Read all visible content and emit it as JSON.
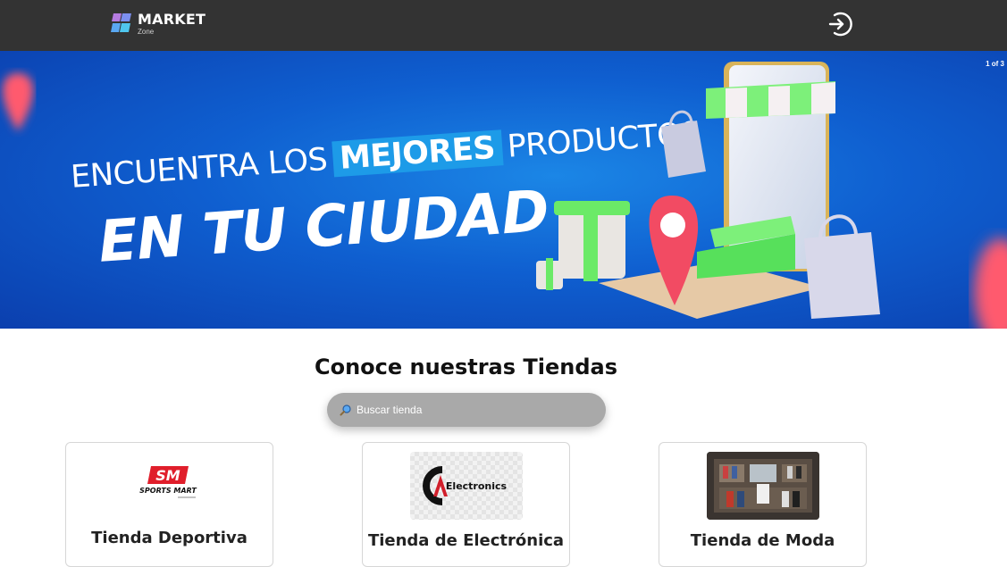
{
  "header": {
    "brand_title": "MARKET",
    "brand_subtitle": "Zone",
    "login_icon": "login-icon"
  },
  "banner": {
    "counter": "1 of 3",
    "line1_before": "ENCUENTRA LOS",
    "line1_highlight": "MEJORES",
    "line1_after": "PRODUCTOS",
    "line2": "EN TU CIUDAD"
  },
  "stores_section": {
    "title": "Conoce nuestras Tiendas",
    "search_placeholder": "Buscar tienda",
    "stores": [
      {
        "name": "Tienda Deportiva",
        "logo_text": "SM",
        "logo_caption": "SPORTS MART"
      },
      {
        "name": "Tienda de Electrónica",
        "logo_text": "Electronics"
      },
      {
        "name": "Tienda de Moda"
      }
    ]
  },
  "colors": {
    "header_bg": "#333333",
    "banner_blue": "#0f5fd0",
    "search_bg": "#a9a9a9"
  }
}
